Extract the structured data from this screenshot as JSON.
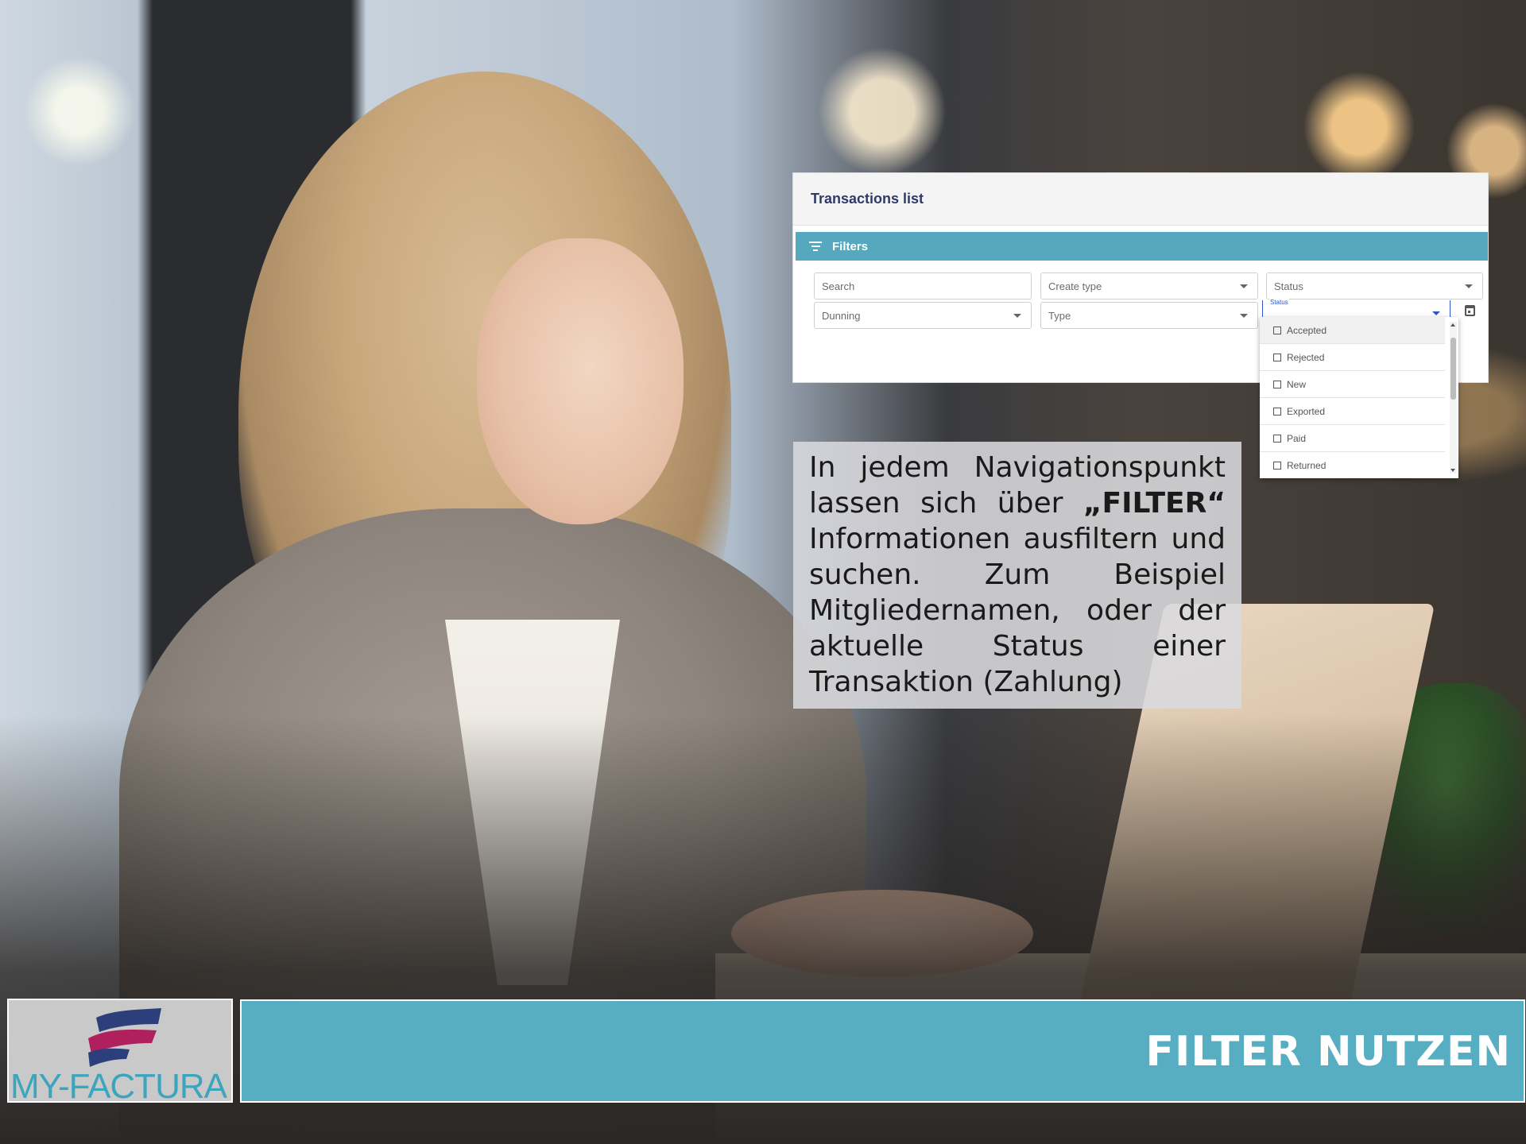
{
  "screenshot": {
    "title": "Transactions list",
    "filters_label": "Filters",
    "fields": {
      "search": "Search",
      "create_type": "Create type",
      "status": "Status",
      "dunning": "Dunning",
      "type": "Type",
      "status_mini_label": "Status"
    },
    "status_options": [
      "Accepted",
      "Rejected",
      "New",
      "Exported",
      "Paid",
      "Returned"
    ]
  },
  "info": {
    "text_before": "In jedem Navigationspunkt lassen sich über ",
    "highlight": "„FILTER“",
    "text_after": " Informationen ausfiltern und suchen. Zum Beispiel Mitgliedernamen, oder der aktuelle Status einer Transaktion (Zahlung)"
  },
  "footer": {
    "logo_text": "MY-FACTURA",
    "title": "FILTER NUTZEN"
  },
  "colors": {
    "accent": "#57adc2",
    "filters_bar": "#55a8bd",
    "title_text": "#2f3a6b",
    "focus": "#2e55c7",
    "logo_magenta": "#b0205c",
    "logo_navy": "#2c3f7a"
  },
  "icons": {
    "filters": "filter-lines-icon",
    "dropdown": "caret-down-icon",
    "calendar": "calendar-icon",
    "checkbox": "checkbox-empty-icon"
  }
}
